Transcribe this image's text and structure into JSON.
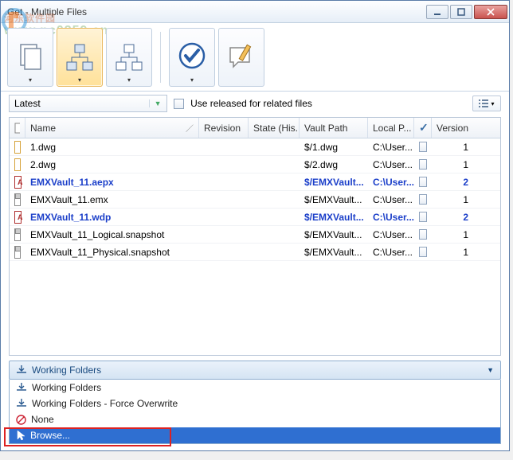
{
  "window": {
    "title": "Get - Multiple Files"
  },
  "watermark": {
    "line1": "河东软件园",
    "line2": "www.pc0359.cn"
  },
  "ribbon": {
    "buttons": [
      "copy-stack",
      "org-chart-1",
      "org-chart-2",
      "check-shield",
      "note-edit"
    ]
  },
  "filter": {
    "combo_value": "Latest",
    "released_label": "Use released for related files"
  },
  "columns": {
    "name": "Name",
    "revision": "Revision",
    "state": "State (His...",
    "vault_path": "Vault Path",
    "local_path": "Local P...",
    "version": "Version"
  },
  "rows": [
    {
      "icon": "dwg",
      "name": "1.dwg",
      "bold": false,
      "rev": "",
      "state": "",
      "vp": "$/1.dwg",
      "lp": "C:\\User...",
      "ver": "1"
    },
    {
      "icon": "dwg",
      "name": "2.dwg",
      "bold": false,
      "rev": "",
      "state": "",
      "vp": "$/2.dwg",
      "lp": "C:\\User...",
      "ver": "1"
    },
    {
      "icon": "proj",
      "name": "EMXVault_11.aepx",
      "bold": true,
      "rev": "",
      "state": "",
      "vp": "$/EMXVault...",
      "lp": "C:\\User...",
      "ver": "2"
    },
    {
      "icon": "gen",
      "name": "EMXVault_11.emx",
      "bold": false,
      "rev": "",
      "state": "",
      "vp": "$/EMXVault...",
      "lp": "C:\\User...",
      "ver": "1"
    },
    {
      "icon": "proj",
      "name": "EMXVault_11.wdp",
      "bold": true,
      "rev": "",
      "state": "",
      "vp": "$/EMXVault...",
      "lp": "C:\\User...",
      "ver": "2"
    },
    {
      "icon": "gen",
      "name": "EMXVault_11_Logical.snapshot",
      "bold": false,
      "rev": "",
      "state": "",
      "vp": "$/EMXVault...",
      "lp": "C:\\User...",
      "ver": "1"
    },
    {
      "icon": "gen",
      "name": "EMXVault_11_Physical.snapshot",
      "bold": false,
      "rev": "",
      "state": "",
      "vp": "$/EMXVault...",
      "lp": "C:\\User...",
      "ver": "1"
    }
  ],
  "footer": {
    "selected": "Working Folders",
    "options": [
      "Working Folders",
      "Working Folders - Force Overwrite",
      "None",
      "Browse..."
    ]
  }
}
